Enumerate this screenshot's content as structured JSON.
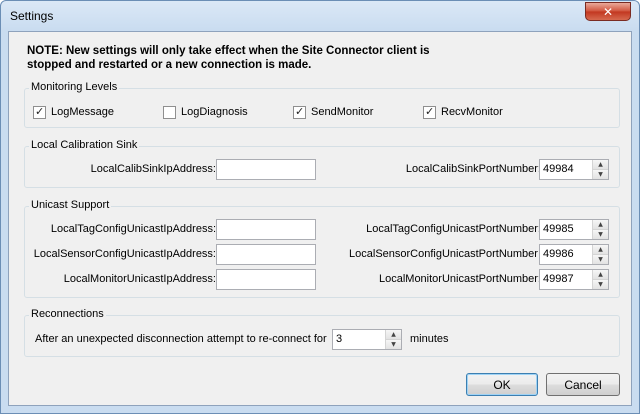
{
  "window": {
    "title": "Settings"
  },
  "note": "NOTE: New settings will only take effect when the Site Connector client is stopped and restarted or a new connection is made.",
  "monitoring": {
    "label": "Monitoring Levels",
    "items": [
      {
        "label": "LogMessage",
        "checked": true
      },
      {
        "label": "LogDiagnosis",
        "checked": false
      },
      {
        "label": "SendMonitor",
        "checked": true
      },
      {
        "label": "RecvMonitor",
        "checked": true
      }
    ]
  },
  "calibration": {
    "label": "Local Calibration Sink",
    "ip_label": "LocalCalibSinkIpAddress:",
    "ip_value": "",
    "port_label": "LocalCalibSinkPortNumber:",
    "port_value": "49984"
  },
  "unicast": {
    "label": "Unicast Support",
    "rows": [
      {
        "ip_label": "LocalTagConfigUnicastIpAddress:",
        "ip_value": "",
        "port_label": "LocalTagConfigUnicastPortNumber:",
        "port_value": "49985"
      },
      {
        "ip_label": "LocalSensorConfigUnicastIpAddress:",
        "ip_value": "",
        "port_label": "LocalSensorConfigUnicastPortNumber:",
        "port_value": "49986"
      },
      {
        "ip_label": "LocalMonitorUnicastIpAddress:",
        "ip_value": "",
        "port_label": "LocalMonitorUnicastPortNumber:",
        "port_value": "49987"
      }
    ]
  },
  "reconnections": {
    "label": "Reconnections",
    "prefix": "After an unexpected disconnection attempt to re-connect for",
    "value": "3",
    "suffix": "minutes"
  },
  "buttons": {
    "ok": "OK",
    "cancel": "Cancel"
  },
  "icons": {
    "close": "close-icon",
    "check": "checkmark-icon",
    "spin_up": "spin-up-arrow-icon",
    "spin_down": "spin-down-arrow-icon"
  },
  "colors": {
    "title_frame": "#c9dcf0",
    "close_button": "#c2361f",
    "dialog_bg": "#f0f0f0",
    "default_button_border": "#3c7fb1"
  }
}
